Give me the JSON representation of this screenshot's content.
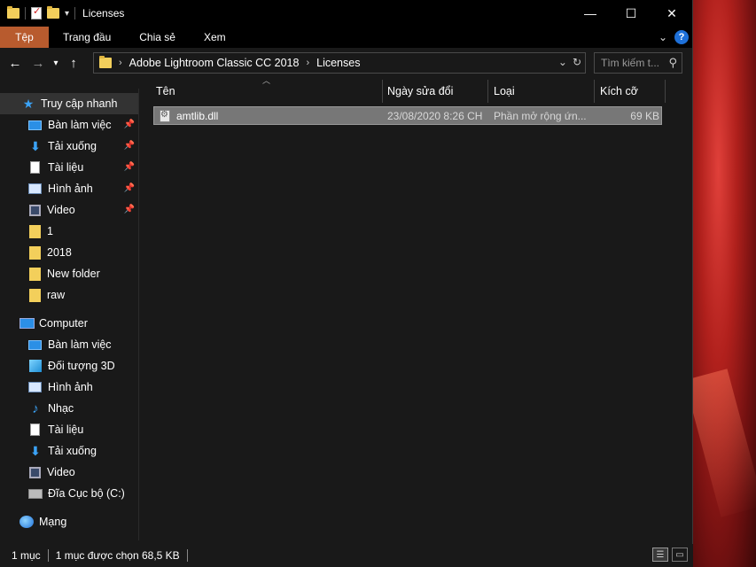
{
  "window": {
    "title": "Licenses"
  },
  "controls": {
    "minimize": "—",
    "maximize": "☐",
    "close": "✕"
  },
  "ribbon": {
    "tabs": [
      "Tệp",
      "Trang đầu",
      "Chia sẻ",
      "Xem"
    ],
    "help": "?"
  },
  "address": {
    "breadcrumbs": [
      "Adobe Lightroom Classic CC 2018",
      "Licenses"
    ],
    "search_placeholder": "Tìm kiếm t..."
  },
  "sidebar": {
    "quick_access": "Truy cập nhanh",
    "quick_items": [
      {
        "label": "Bàn làm việc",
        "icon": "desktop-icon",
        "pinned": true
      },
      {
        "label": "Tải xuống",
        "icon": "downloads-icon",
        "pinned": true
      },
      {
        "label": "Tài liệu",
        "icon": "documents-icon",
        "pinned": true
      },
      {
        "label": "Hình ảnh",
        "icon": "pictures-icon",
        "pinned": true
      },
      {
        "label": "Video",
        "icon": "videos-icon",
        "pinned": true
      },
      {
        "label": "1",
        "icon": "folder-icon",
        "pinned": false
      },
      {
        "label": "2018",
        "icon": "folder-icon",
        "pinned": false
      },
      {
        "label": "New folder",
        "icon": "folder-icon",
        "pinned": false
      },
      {
        "label": "raw",
        "icon": "folder-icon",
        "pinned": false
      }
    ],
    "computer": "Computer",
    "computer_items": [
      {
        "label": "Bàn làm việc",
        "icon": "desktop-icon"
      },
      {
        "label": "Đối tượng 3D",
        "icon": "3d-objects-icon"
      },
      {
        "label": "Hình ảnh",
        "icon": "pictures-icon"
      },
      {
        "label": "Nhạc",
        "icon": "music-icon"
      },
      {
        "label": "Tài liệu",
        "icon": "documents-icon"
      },
      {
        "label": "Tải xuống",
        "icon": "downloads-icon"
      },
      {
        "label": "Video",
        "icon": "videos-icon"
      },
      {
        "label": "Đĩa Cục bộ (C:)",
        "icon": "drive-icon"
      }
    ],
    "network": "Mạng"
  },
  "columns": {
    "name": "Tên",
    "modified": "Ngày sửa đổi",
    "type": "Loại",
    "size": "Kích cỡ"
  },
  "files": [
    {
      "name": "amtlib.dll",
      "modified": "23/08/2020 8:26 CH",
      "type": "Phần mở rộng ứn...",
      "size": "69 KB"
    }
  ],
  "status": {
    "count": "1 mục",
    "selected": "1 mục được chọn  68,5 KB"
  }
}
